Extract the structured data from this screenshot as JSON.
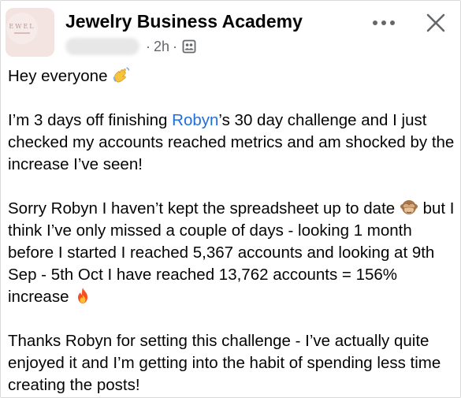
{
  "header": {
    "group_name": "Jewelry Business Academy",
    "avatar_text": "EWEL",
    "time": "2h",
    "separator": "·"
  },
  "icons": {
    "more": "more-horizontal-icon",
    "close": "close-icon",
    "audience": "group-members-icon",
    "wave": "waving-hand-emoji",
    "monkey": "see-no-evil-monkey-emoji",
    "fire": "fire-emoji"
  },
  "post": {
    "greeting": "Hey everyone",
    "p1_a": "I’m 3 days off finishing ",
    "p1_link": "Robyn",
    "p1_b": "’s 30 day challenge and I just checked my accounts reached metrics and am shocked by the increase I’ve seen!",
    "p2_a": "Sorry Robyn I haven’t kept the spreadsheet up to date",
    "p2_b": " but I think I’ve only missed a couple of days - looking 1 month before I started I reached 5,367 accounts and looking at 9th Sep - 5th Oct I have reached 13,762 accounts = 156% increase",
    "p3": "Thanks Robyn for setting this challenge - I’ve actually quite enjoyed it and I’m getting into the habit of spending less time creating the posts!"
  },
  "colors": {
    "link": "#216fdb",
    "secondary_text": "#65676b",
    "text": "#050505"
  }
}
